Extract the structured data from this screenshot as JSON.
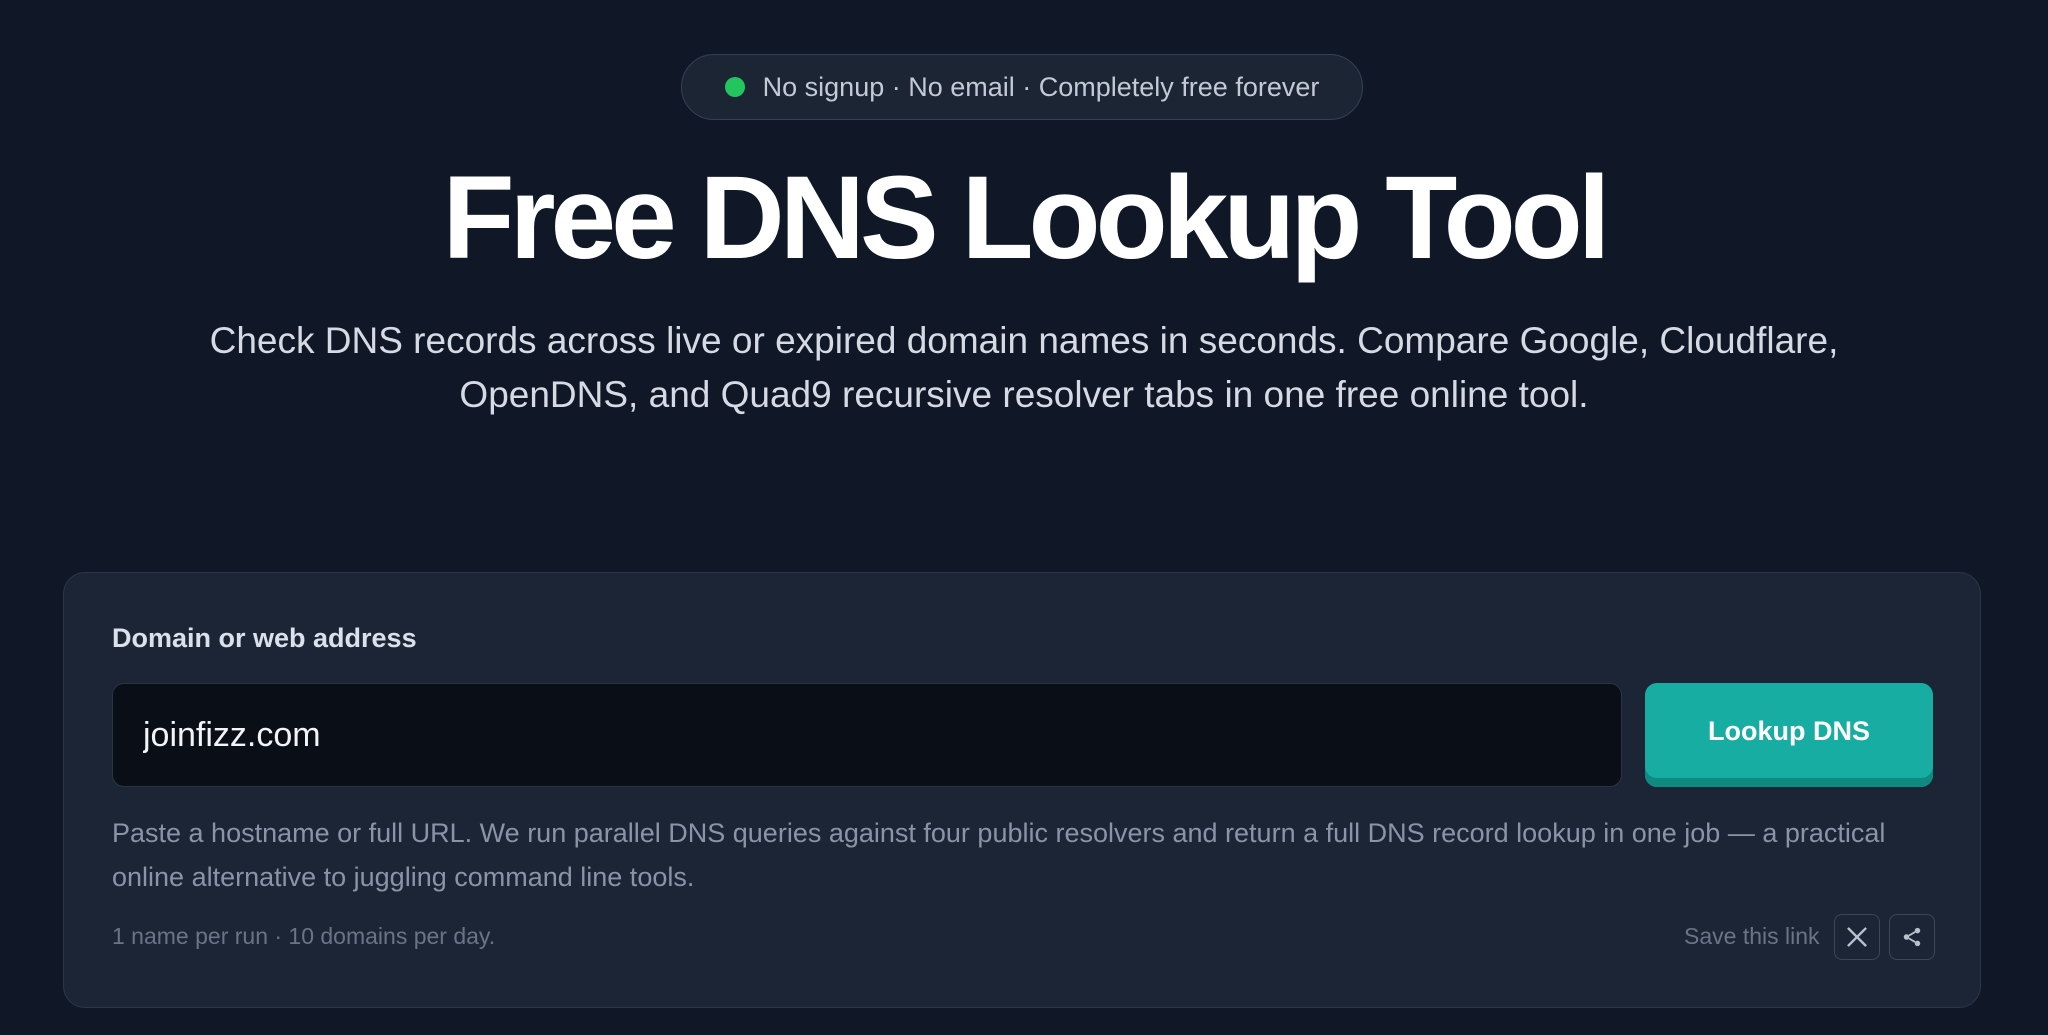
{
  "badge": {
    "text": "No signup · No email · Completely free forever",
    "status_color": "#22c55e"
  },
  "hero": {
    "title": "Free DNS Lookup Tool",
    "subtitle": "Check DNS records across live or expired domain names in seconds. Compare Google, Cloudflare, OpenDNS, and Quad9 recursive resolver tabs in one free online tool."
  },
  "form": {
    "label": "Domain or web address",
    "input_value": "joinfizz.com",
    "button_label": "Lookup DNS",
    "button_color": "#17ada3",
    "help_text": "Paste a hostname or full URL. We run parallel DNS queries against four public resolvers and return a full DNS record lookup in one job — a practical online alternative to juggling command line tools.",
    "limits_text": "1 name per run · 10 domains per day.",
    "save_link_text": "Save this link",
    "share_icons": [
      "x-icon",
      "share-icon"
    ]
  }
}
